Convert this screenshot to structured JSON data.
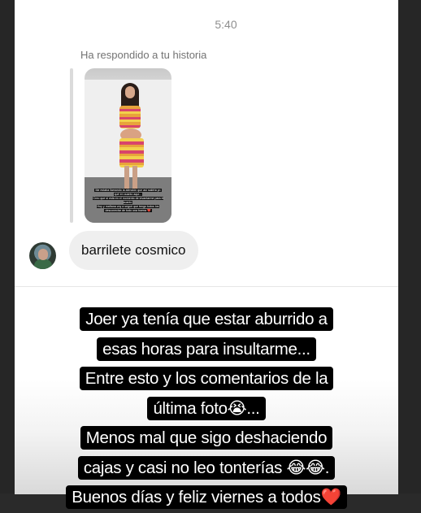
{
  "chat": {
    "time": "5:40",
    "reply_notice": "Ha respondido a tu historia",
    "story_caption": [
      "Me estaba llamando la atención que así saldría yo",
      "qué en cuanto aquí...",
      "Creo que sí está en el momento de levantarme para él cuanto",
      "Hoy y mañana voy a seguir que tengo todos los",
      "desconectar de todo una buena ❤️"
    ],
    "message": "barrilete cosmico"
  },
  "story": {
    "lines": [
      "Joer ya tenía que estar aburrido a",
      "esas horas para insultarme...",
      "Entre esto y los comentarios de la",
      "última foto😭...",
      "Menos mal que sigo deshaciendo",
      "cajas y casi no leo tonterías 😂😂.",
      "Buenos días y feliz viernes a todos❤️"
    ]
  },
  "colors": {
    "bubble": "#efefef",
    "muted_text": "#8e8e8e",
    "story_text_bg": "#000000"
  }
}
